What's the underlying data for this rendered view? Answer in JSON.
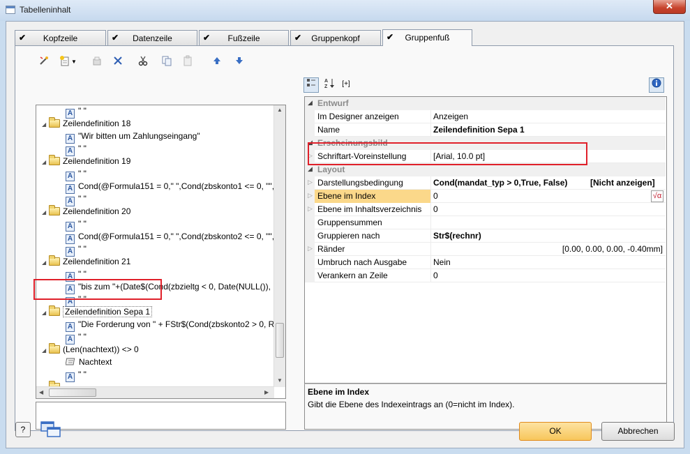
{
  "window": {
    "title": "Tabelleninhalt",
    "close_glyph": "✕"
  },
  "tabs": [
    {
      "label": "Kopfzeile",
      "check": "✔"
    },
    {
      "label": "Datenzeile",
      "check": "✔"
    },
    {
      "label": "Fußzeile",
      "check": "✔"
    },
    {
      "label": "Gruppenkopf",
      "check": "✔"
    },
    {
      "label": "Gruppenfuß",
      "check": "✔"
    }
  ],
  "toolbar": {
    "icons": [
      "properties-wand-icon",
      "new-item-icon",
      "dropdown-arrow-icon",
      "disabled-icon",
      "delete-icon",
      "cut-icon",
      "copy-icon",
      "paste-icon",
      "move-up-icon",
      "move-down-icon"
    ]
  },
  "tree": {
    "items": [
      {
        "type": "text",
        "label": "\" \""
      },
      {
        "type": "folder",
        "label": "Zeilendefinition 18"
      },
      {
        "type": "text",
        "label": "\"Wir bitten um Zahlungseingang\""
      },
      {
        "type": "text",
        "label": "\" \""
      },
      {
        "type": "folder",
        "label": "Zeilendefinition 19"
      },
      {
        "type": "text",
        "label": "\" \""
      },
      {
        "type": "text",
        "label": "Cond(@Formula151 = 0,\" \",Cond(zbskonto1 <= 0, \"\","
      },
      {
        "type": "text",
        "label": "\" \""
      },
      {
        "type": "folder",
        "label": "Zeilendefinition 20"
      },
      {
        "type": "text",
        "label": "\" \""
      },
      {
        "type": "text",
        "label": "Cond(@Formula151 = 0,\" \",Cond(zbskonto2 <= 0, \"\","
      },
      {
        "type": "text",
        "label": "\" \""
      },
      {
        "type": "folder",
        "label": "Zeilendefinition 21"
      },
      {
        "type": "text",
        "label": "\" \""
      },
      {
        "type": "text",
        "label": "\"bis zum  \"+(Date$(Cond(zbzieltg < 0, Date(NULL()),"
      },
      {
        "type": "text",
        "label": "\" \""
      },
      {
        "type": "folder",
        "label": "Zeilendefinition Sepa 1"
      },
      {
        "type": "text",
        "label": "\"Die Forderung von \" + FStr$(Cond(zbskonto2 > 0, Ro"
      },
      {
        "type": "text",
        "label": "\" \""
      },
      {
        "type": "folder",
        "label": "(Len(nachtext)) <> 0"
      },
      {
        "type": "note",
        "label": "Nachtext"
      },
      {
        "type": "text",
        "label": "\" \""
      },
      {
        "type": "folder",
        "label": ""
      }
    ]
  },
  "propgrid": {
    "toolbar_icons": [
      "categorized-icon",
      "sort-az-icon",
      "expand-all-icon",
      "info-icon"
    ],
    "expand_all_label": "[+]",
    "rows": [
      {
        "kind": "category",
        "name": "Entwurf"
      },
      {
        "kind": "prop",
        "name": "Im Designer anzeigen",
        "value": "Anzeigen"
      },
      {
        "kind": "prop",
        "name": "Name",
        "value": "Zeilendefinition Sepa 1",
        "bold": true
      },
      {
        "kind": "category",
        "name": "Erscheinungsbild"
      },
      {
        "kind": "prop",
        "name": "Schriftart-Voreinstellung",
        "value": "[Arial, 10.0 pt]",
        "expandable": true
      },
      {
        "kind": "category",
        "name": "Layout"
      },
      {
        "kind": "prop",
        "name": "Darstellungsbedingung",
        "value": "Cond(mandat_typ > 0,True, False)",
        "value2": "[Nicht anzeigen]",
        "bold": true
      },
      {
        "kind": "prop",
        "name": "Ebene im Index",
        "value": "0",
        "selected": true,
        "expandable": true,
        "button": "√α"
      },
      {
        "kind": "prop",
        "name": "Ebene im Inhaltsverzeichnis",
        "value": "0",
        "expandable": true
      },
      {
        "kind": "prop",
        "name": "Gruppensummen",
        "value": ""
      },
      {
        "kind": "prop",
        "name": "Gruppieren nach",
        "value": "Str$(rechnr)",
        "bold": true
      },
      {
        "kind": "prop",
        "name": "Ränder",
        "value": "[0.00, 0.00, 0.00, -0.40mm]",
        "expandable": true,
        "align_right": true
      },
      {
        "kind": "prop",
        "name": "Umbruch nach Ausgabe",
        "value": "Nein"
      },
      {
        "kind": "prop",
        "name": "Verankern an Zeile",
        "value": "0"
      }
    ],
    "description": {
      "title": "Ebene im Index",
      "text": "Gibt die Ebene des Indexeintrags an (0=nicht im Index)."
    }
  },
  "buttons": {
    "ok": "OK",
    "cancel": "Abbrechen",
    "help": "?"
  },
  "colors": {
    "annotation_red": "#e0202a",
    "selection": "#fbd88a",
    "window_frame": "#c9dcef"
  }
}
